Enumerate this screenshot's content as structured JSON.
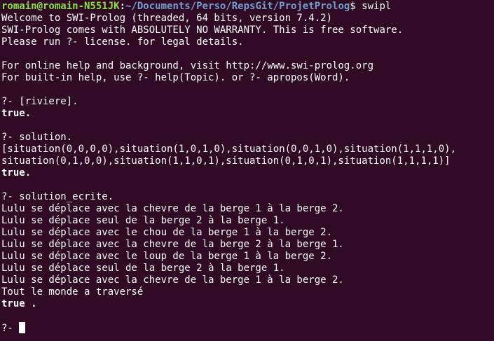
{
  "shell_prompt": {
    "user_host": "romain@romain-N551JK",
    "colon": ":",
    "path": "~/Documents/Perso/RepsGit/ProjetProlog",
    "dollar": "$ ",
    "command": "swipl"
  },
  "banner": [
    "Welcome to SWI-Prolog (threaded, 64 bits, version 7.4.2)",
    "SWI-Prolog comes with ABSOLUTELY NO WARRANTY. This is free software.",
    "Please run ?- license. for legal details.",
    "",
    "For online help and background, visit http://www.swi-prolog.org",
    "For built-in help, use ?- help(Topic). or ?- apropos(Word)."
  ],
  "query1": {
    "prompt": "?- [riviere].",
    "result": "true."
  },
  "query2": {
    "prompt": "?- solution.",
    "output": [
      "[situation(0,0,0,0),situation(1,0,1,0),situation(0,0,1,0),situation(1,1,1,0),",
      "situation(0,1,0,0),situation(1,1,0,1),situation(0,1,0,1),situation(1,1,1,1)]"
    ],
    "result": "true."
  },
  "query3": {
    "prompt": "?- solution_ecrite.",
    "output": [
      "Lulu se déplace avec la chevre de la berge 1 à la berge 2.",
      "Lulu se déplace seul de la berge 2 à la berge 1.",
      "Lulu se déplace avec le chou de la berge 1 à la berge 2.",
      "Lulu se déplace avec la chevre de la berge 2 à la berge 1.",
      "Lulu se déplace avec le loup de la berge 1 à la berge 2.",
      "Lulu se déplace seul de la berge 2 à la berge 1.",
      "Lulu se déplace avec la chevre de la berge 1 à la berge 2.",
      "Tout le monde a traversé"
    ],
    "result_word": "true",
    "result_dot": " ."
  },
  "current_prompt": "?- "
}
